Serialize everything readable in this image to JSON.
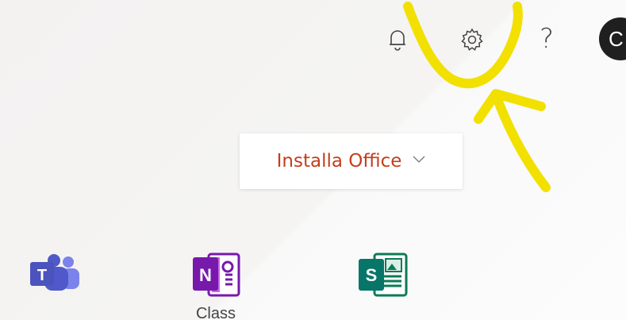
{
  "header": {
    "icons": [
      "bell-icon",
      "gear-icon",
      "help-icon"
    ],
    "help_glyph": "?",
    "avatar_initial": "C"
  },
  "install_button": {
    "label": "Installa Office",
    "color": "#c43e1c"
  },
  "apps": [
    {
      "icon": "teams-icon",
      "label": ""
    },
    {
      "icon": "onenote-icon",
      "label": "Class"
    },
    {
      "icon": "sway-icon",
      "label": ""
    }
  ],
  "annotation": {
    "color": "#f2e000"
  }
}
